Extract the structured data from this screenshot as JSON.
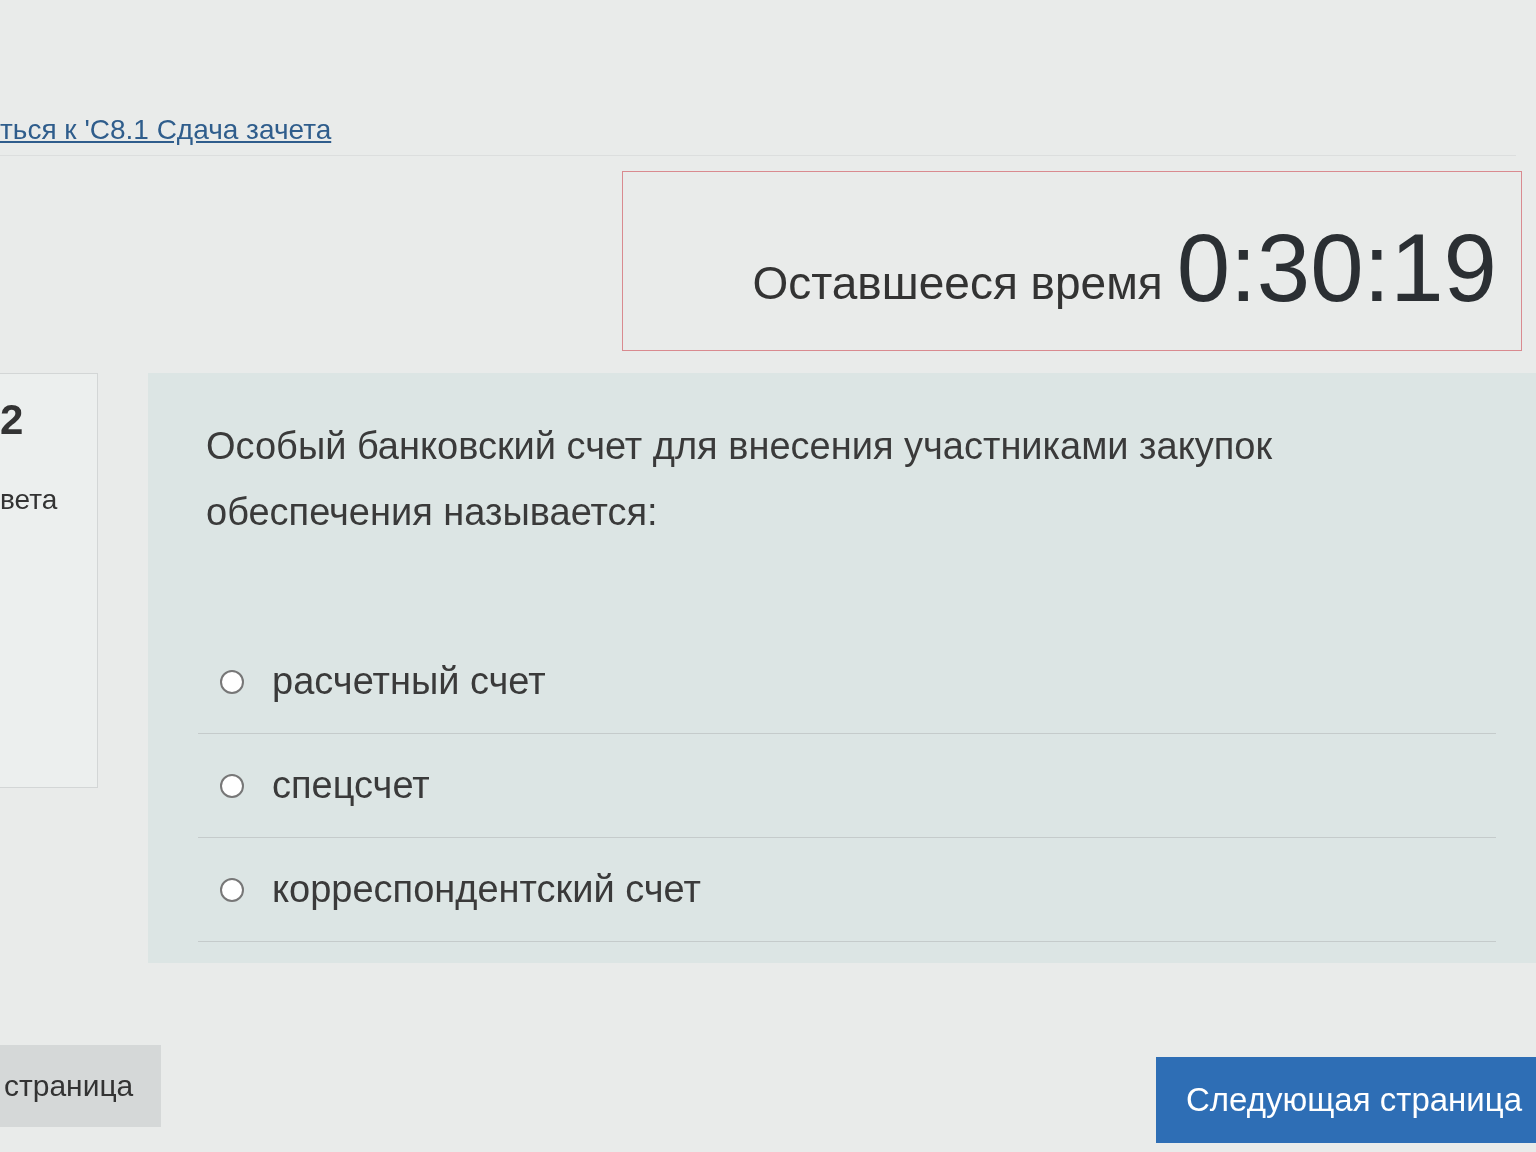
{
  "back_link": "ться к 'С8.1 Сдача зачета",
  "timer": {
    "label": "Оставшееся время",
    "value": "0:30:19"
  },
  "question_info": {
    "number": "2",
    "status": "вета"
  },
  "question": {
    "text": "Особый банковский счет для внесения участниками закупок обеспечения называется:",
    "options": [
      {
        "label": "расчетный счет",
        "selected": false
      },
      {
        "label": "спецсчет",
        "selected": false
      },
      {
        "label": "корреспондентский счет",
        "selected": false
      }
    ]
  },
  "buttons": {
    "previous": "страница",
    "next": "Следующая страница"
  }
}
